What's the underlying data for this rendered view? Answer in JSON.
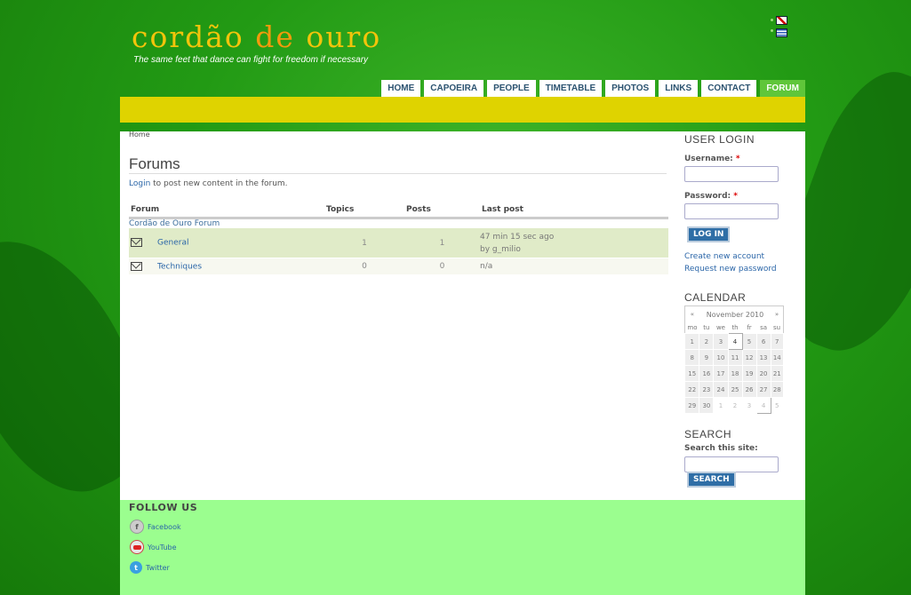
{
  "header": {
    "logo_part1": "cordão ",
    "logo_part2": "de",
    "logo_part3": " ouro",
    "tagline": "The same feet that dance can fight for freedom if necessary"
  },
  "languages": [
    "english-flag",
    "greek-flag"
  ],
  "nav": {
    "items": [
      "HOME",
      "CAPOEIRA",
      "PEOPLE",
      "TIMETABLE",
      "PHOTOS",
      "LINKS",
      "CONTACT",
      "FORUM"
    ],
    "active": "FORUM"
  },
  "breadcrumb": "Home",
  "page_title": "Forums",
  "login_prompt": {
    "link": "Login",
    "text": " to post new content in the forum."
  },
  "table": {
    "headers": [
      "Forum",
      "Topics",
      "Posts",
      "Last post"
    ],
    "category": "Cordão de Ouro Forum",
    "rows": [
      {
        "name": "General",
        "topics": "1",
        "posts": "1",
        "last_post_line1": "47 min 15 sec ago",
        "last_post_line2": "by g_milio"
      },
      {
        "name": "Techniques",
        "topics": "0",
        "posts": "0",
        "last_post_line1": "n/a",
        "last_post_line2": ""
      }
    ]
  },
  "user_login": {
    "title": "USER LOGIN",
    "username_label": "Username:",
    "password_label": "Password:",
    "required": "*",
    "login_button": "LOG IN",
    "create_account": "Create new account",
    "request_password": "Request new password"
  },
  "calendar": {
    "title": "CALENDAR",
    "prev": "«",
    "next": "»",
    "month": "November 2010",
    "dows": [
      "mo",
      "tu",
      "we",
      "th",
      "fr",
      "sa",
      "su"
    ],
    "weeks": [
      [
        "1",
        "2",
        "3",
        "4",
        "5",
        "6",
        "7"
      ],
      [
        "8",
        "9",
        "10",
        "11",
        "12",
        "13",
        "14"
      ],
      [
        "15",
        "16",
        "17",
        "18",
        "19",
        "20",
        "21"
      ],
      [
        "22",
        "23",
        "24",
        "25",
        "26",
        "27",
        "28"
      ],
      [
        "29",
        "30",
        "1",
        "2",
        "3",
        "4",
        "5"
      ]
    ],
    "today": "4"
  },
  "search": {
    "title": "SEARCH",
    "label": "Search this site:",
    "button": "SEARCH"
  },
  "footer": {
    "title": "FOLLOW US",
    "links": [
      "Facebook",
      "YouTube",
      "Twitter"
    ]
  },
  "colors": {
    "bg_green": "#229a14",
    "yellow_bar": "#dfd300",
    "footer_green": "#9bfe8f",
    "nav_active": "#5fc63a",
    "link_blue": "#2b66a8",
    "logo_yellow": "#f2c40b"
  }
}
